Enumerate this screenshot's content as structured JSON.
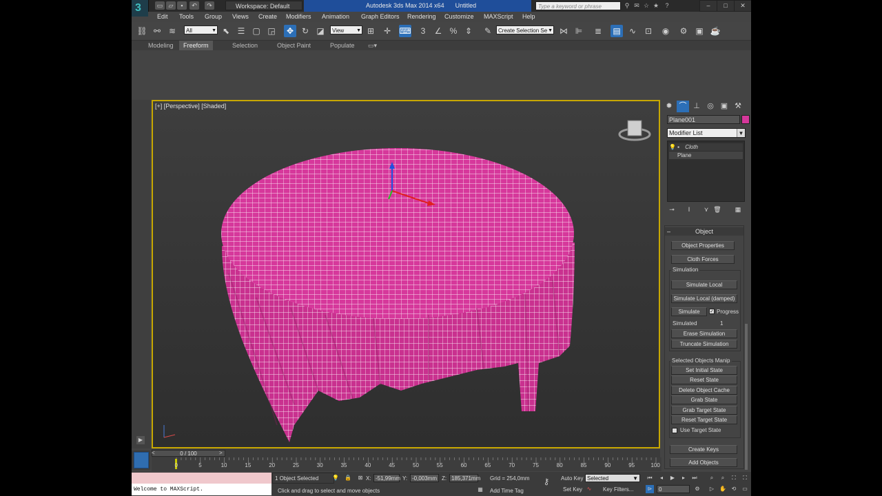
{
  "titlebar": {
    "workspace": "Workspace: Default",
    "app_title": "Autodesk 3ds Max  2014 x64",
    "doc_title": "Untitled",
    "search_placeholder": "Type a keyword or phrase"
  },
  "menu": [
    "Edit",
    "Tools",
    "Group",
    "Views",
    "Create",
    "Modifiers",
    "Animation",
    "Graph Editors",
    "Rendering",
    "Customize",
    "MAXScript",
    "Help"
  ],
  "toolbar": {
    "selection_filter": "All",
    "ref_coord": "View",
    "named_selection": "Create Selection Se"
  },
  "ribbon_tabs": [
    "Modeling",
    "Freeform",
    "Selection",
    "Object Paint",
    "Populate"
  ],
  "ribbon_active": "Freeform",
  "viewport": {
    "label": "[+] [Perspective] [Shaded]",
    "cloth_color": "#d6389b",
    "border_color": "#c8a800"
  },
  "command_panel": {
    "object_name": "Plane001",
    "object_color": "#d6389b",
    "modifier_list": "Modifier List",
    "stack": [
      "Cloth",
      "Plane"
    ],
    "rollout_title": "Object",
    "object_properties": "Object Properties",
    "cloth_forces": "Cloth Forces",
    "simulation_group": "Simulation",
    "simulate_local": "Simulate Local",
    "simulate_local_damped": "Simulate Local (damped)",
    "simulate": "Simulate",
    "progress": "Progress",
    "simulated_label": "Simulated",
    "simulated_value": "1",
    "erase_simulation": "Erase Simulation",
    "truncate_simulation": "Truncate Simulation",
    "selected_group": "Selected Objects Manip",
    "set_initial_state": "Set Initial State",
    "reset_state": "Reset State",
    "delete_object_cache": "Delete Object Cache",
    "grab_state": "Grab State",
    "grab_target_state": "Grab Target State",
    "reset_target_state": "Reset Target State",
    "use_target_state": "Use Target State",
    "create_keys": "Create Keys",
    "add_objects": "Add Objects"
  },
  "timeline": {
    "frame": "0 / 100",
    "ticks": [
      "0",
      "5",
      "10",
      "15",
      "20",
      "25",
      "30",
      "35",
      "40",
      "45",
      "50",
      "55",
      "60",
      "65",
      "70",
      "75",
      "80",
      "85",
      "90",
      "95",
      "100"
    ]
  },
  "status": {
    "maxscript": "Welcome to MAXScript.",
    "selection": "1 Object Selected",
    "prompt": "Click and drag to select and move objects",
    "x_label": "X:",
    "x": "-51,99mm",
    "y_label": "Y:",
    "y": "-0,003mm",
    "z_label": "Z:",
    "z": "185,371mm",
    "grid": "Grid = 254,0mm",
    "add_time_tag": "Add Time Tag",
    "auto_key": "Auto Key",
    "set_key": "Set Key",
    "key_mode": "Selected",
    "key_filters": "Key Filters...",
    "frame_field": "0"
  }
}
